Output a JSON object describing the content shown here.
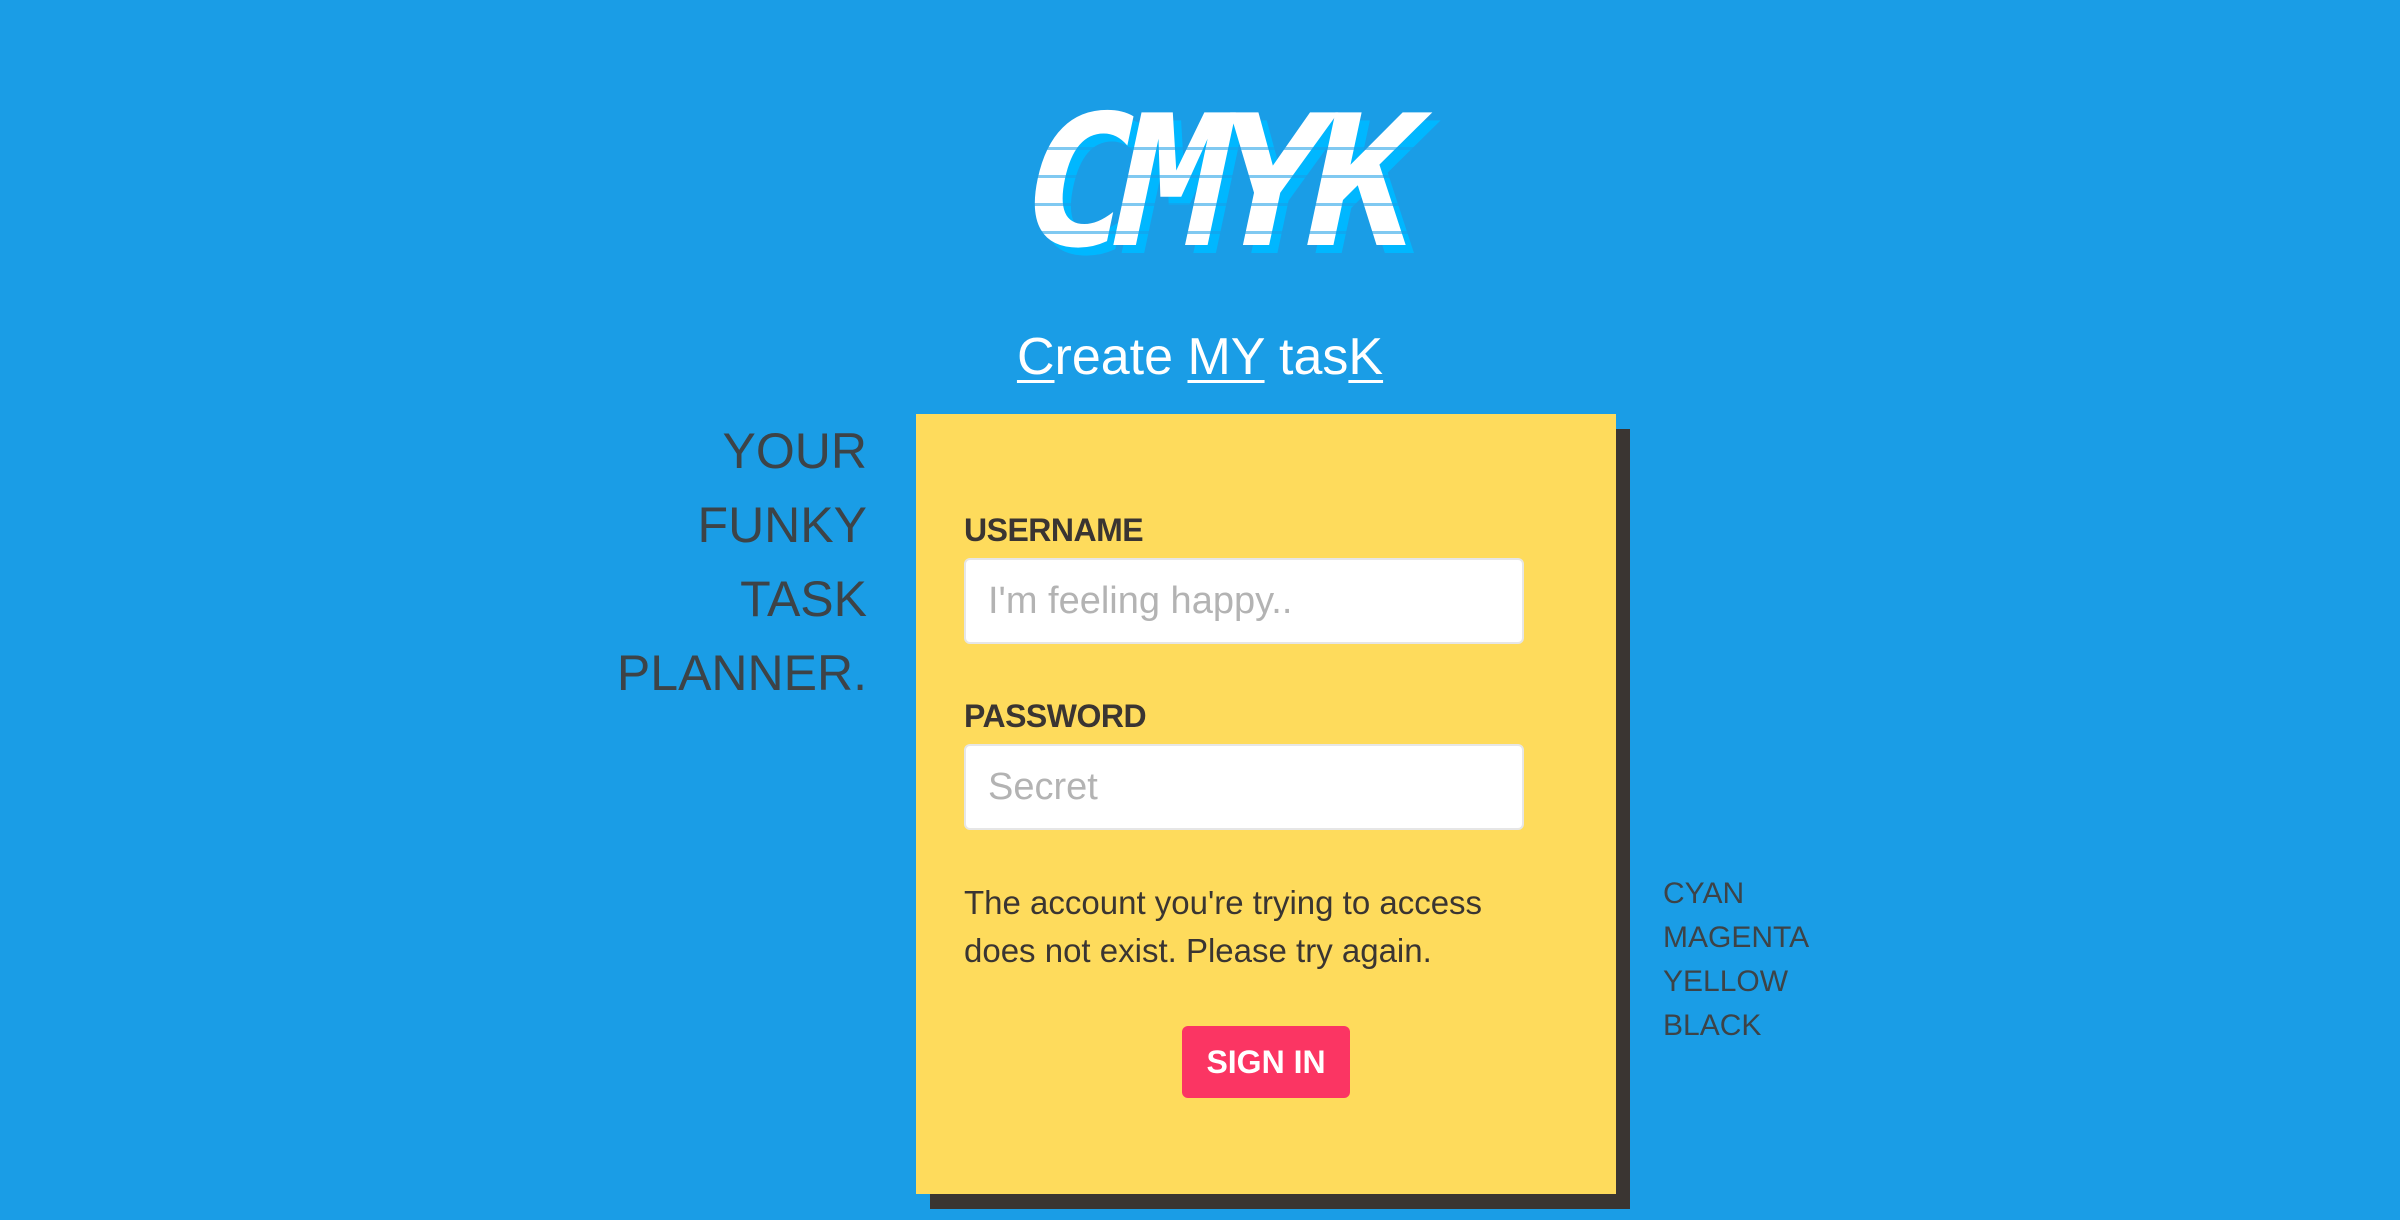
{
  "logo": {
    "text": "CMYK",
    "colors": {
      "main": "#ffffff",
      "shadow": "#00b7ff"
    }
  },
  "subtitle": {
    "parts": [
      {
        "text": "C",
        "underline": true
      },
      {
        "text": "reate ",
        "underline": false
      },
      {
        "text": "MY",
        "underline": true
      },
      {
        "text": " tas",
        "underline": false
      },
      {
        "text": "K",
        "underline": true
      }
    ]
  },
  "tagline": [
    "YOUR",
    "FUNKY",
    "TASK",
    "PLANNER."
  ],
  "form": {
    "username_label": "USERNAME",
    "username_placeholder": "I'm feeling happy..",
    "username_value": "",
    "password_label": "PASSWORD",
    "password_placeholder": "Secret",
    "password_value": "",
    "error_message": "The account you're trying to access does not exist. Please try again.",
    "signin_label": "SIGN IN"
  },
  "color_list": [
    "CYAN",
    "MAGENTA",
    "YELLOW",
    "BLACK"
  ],
  "theme": {
    "background": "#1a9de6",
    "card": "#fedb5c",
    "card_shadow": "#3a3532",
    "button": "#fb3563",
    "text_dark": "#3d4347"
  }
}
